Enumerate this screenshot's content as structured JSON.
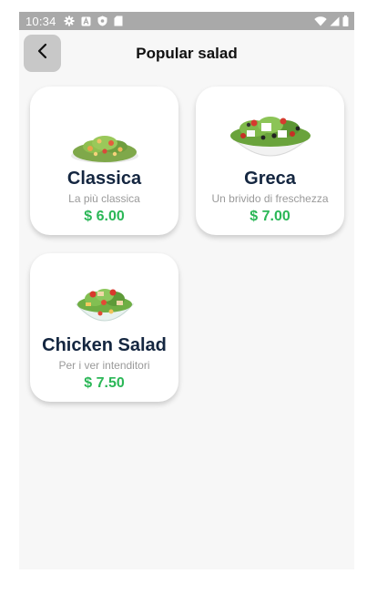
{
  "status_bar": {
    "time": "10:34",
    "icons": [
      "settings-icon",
      "a-box-icon",
      "shield-icon",
      "sd-card-icon",
      "wifi-icon",
      "signal-icon",
      "battery-icon"
    ]
  },
  "header": {
    "title": "Popular salad",
    "back_icon": "chevron-left-icon"
  },
  "salads": [
    {
      "name": "Classica",
      "description": "La più classica",
      "price": "$ 6.00"
    },
    {
      "name": "Greca",
      "description": "Un brivido di freschezza",
      "price": "$ 7.00"
    },
    {
      "name": "Chicken Salad",
      "description": "Per i ver intenditori",
      "price": "$ 7.50"
    }
  ],
  "colors": {
    "status_bar": "#a9a9a9",
    "background": "#f7f7f7",
    "card": "#ffffff",
    "title_text": "#142640",
    "price": "#2bb757",
    "description": "#9a9a9a",
    "back_button": "#c8c8c8"
  }
}
